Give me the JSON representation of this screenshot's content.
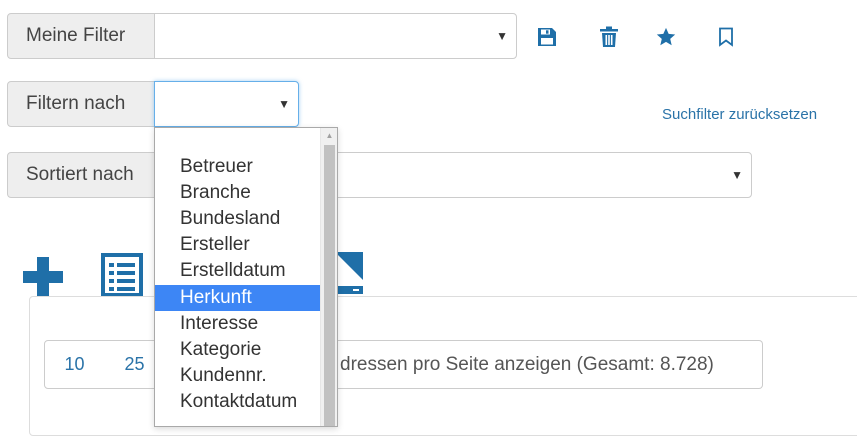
{
  "filters": {
    "my_filter_label": "Meine Filter",
    "my_filter_value": "",
    "filter_by_label": "Filtern nach",
    "filter_by_value": "",
    "sort_by_label": "Sortiert nach",
    "sort_by_value": "",
    "reset_link": "Suchfilter zurücksetzen"
  },
  "filter_by_options": [
    "",
    "Betreuer",
    "Branche",
    "Bundesland",
    "Ersteller",
    "Erstelldatum",
    "Herkunft",
    "Interesse",
    "Kategorie",
    "Kundennr.",
    "Kontaktdatum"
  ],
  "selected_option": "Herkunft",
  "pagination": {
    "page_sizes": [
      "10",
      "25"
    ],
    "summary_text": "dressen pro Seite anzeigen (Gesamt: 8.728)"
  },
  "colors": {
    "accent": "#1f6fa8",
    "link": "#2a73a8",
    "selection": "#3d86f5",
    "focus_border": "#66afe9"
  }
}
